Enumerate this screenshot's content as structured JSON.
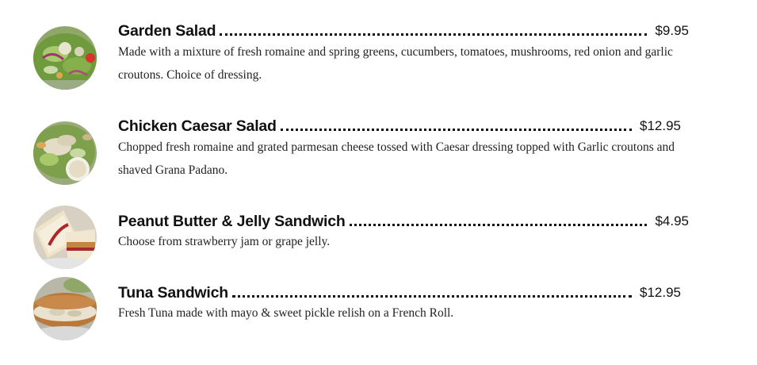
{
  "menu": {
    "items": [
      {
        "name": "Garden Salad",
        "price": "$9.95",
        "description": "Made with a mixture of fresh romaine and spring greens, cucumbers, tomatoes, mushrooms, red onion and garlic croutons. Choice of dressing.",
        "image_icon": "garden-salad-photo"
      },
      {
        "name": "Chicken Caesar Salad",
        "price": "$12.95",
        "description": "Chopped fresh romaine and grated parmesan cheese tossed with Caesar dressing topped with Garlic croutons and shaved Grana Padano.",
        "image_icon": "chicken-caesar-salad-photo"
      },
      {
        "name": "Peanut Butter & Jelly Sandwich",
        "price": "$4.95",
        "description": "Choose from strawberry jam or grape jelly.",
        "image_icon": "pbj-sandwich-photo"
      },
      {
        "name": "Tuna Sandwich",
        "price": "$12.95",
        "description": "Fresh Tuna made with mayo & sweet pickle relish on a French Roll.",
        "image_icon": "tuna-sandwich-photo"
      }
    ]
  }
}
